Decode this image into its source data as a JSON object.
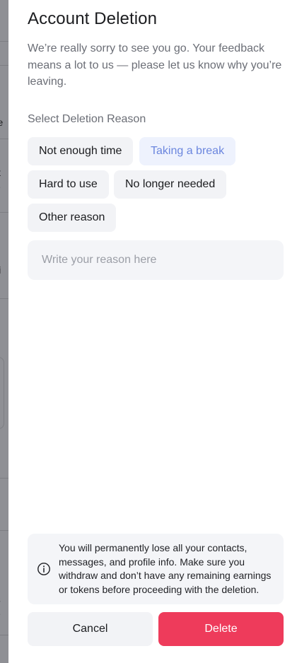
{
  "background_page": {
    "fragments": [
      "are",
      "t",
      "tie",
      "gi",
      "ns",
      "tie"
    ]
  },
  "dialog": {
    "title": "Account Deletion",
    "subtitle": "We’re really sorry to see you go. Your feedback means a lot to us — please let us know why you’re leaving.",
    "section_label": "Select Deletion Reason",
    "reasons": [
      {
        "label": "Not enough time",
        "selected": false
      },
      {
        "label": "Taking a break",
        "selected": true
      },
      {
        "label": "Hard to use",
        "selected": false
      },
      {
        "label": "No longer needed",
        "selected": false
      },
      {
        "label": "Other reason",
        "selected": false
      }
    ],
    "reason_input": {
      "value": "",
      "placeholder": "Write your reason here"
    },
    "notice": {
      "icon": "info-icon",
      "text": "You will permanently lose all your contacts, messages, and profile info. Make sure you withdraw and don’t have any remaining earnings or tokens before proceeding with the deletion."
    },
    "cancel_label": "Cancel",
    "delete_label": "Delete"
  },
  "colors": {
    "accent_selected_text": "#6b86de",
    "accent_selected_bg": "#eef2fd",
    "danger": "#ee3b5b",
    "overlay": "#8f9095"
  }
}
